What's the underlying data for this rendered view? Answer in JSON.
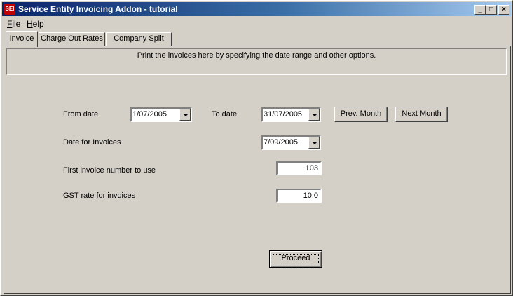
{
  "window": {
    "title": "Service Entity Invoicing Addon - tutorial",
    "icon_name": "sei-app-icon",
    "icon_text": "SEI",
    "controls": {
      "minimize": "_",
      "maximize": "□",
      "close": "×"
    }
  },
  "menu": {
    "file": {
      "hotkey": "F",
      "rest": "ile"
    },
    "help": {
      "hotkey": "H",
      "rest": "elp"
    }
  },
  "tabs": [
    {
      "label": "Invoice",
      "active": true
    },
    {
      "label": "Charge Out Rates",
      "active": false
    },
    {
      "label": "Company Split",
      "active": false
    }
  ],
  "invoice": {
    "info_text": "Print the invoices here by specifying the date range and other options.",
    "from_date_label": "From date",
    "from_date_value": "1/07/2005",
    "to_date_label": "To date",
    "to_date_value": "31/07/2005",
    "prev_month_label": "Prev. Month",
    "next_month_label": "Next Month",
    "invoice_date_label": "Date for Invoices",
    "invoice_date_value": "7/09/2005",
    "first_invoice_label": "First invoice number to use",
    "first_invoice_value": "103",
    "gst_label": "GST rate for invoices",
    "gst_value": "10.0",
    "proceed_label": "Proceed"
  }
}
